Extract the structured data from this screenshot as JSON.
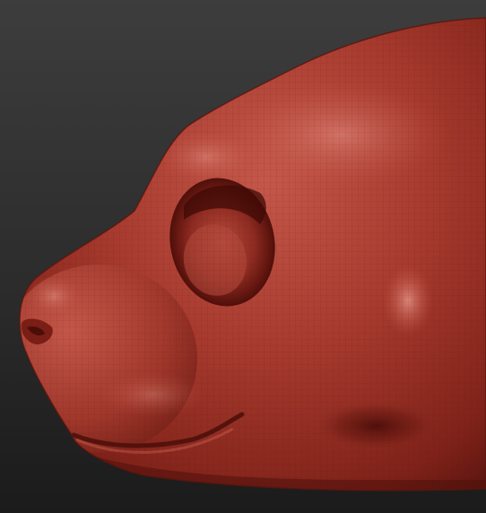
{
  "scene": {
    "subject": "sculpted-animal-head-profile",
    "material_color": "#a8372b",
    "highlight_color": "#e0877a",
    "shadow_color": "#4a0f0a",
    "background_top": "#3c3c3c",
    "background_bottom": "#1a1a1a"
  }
}
